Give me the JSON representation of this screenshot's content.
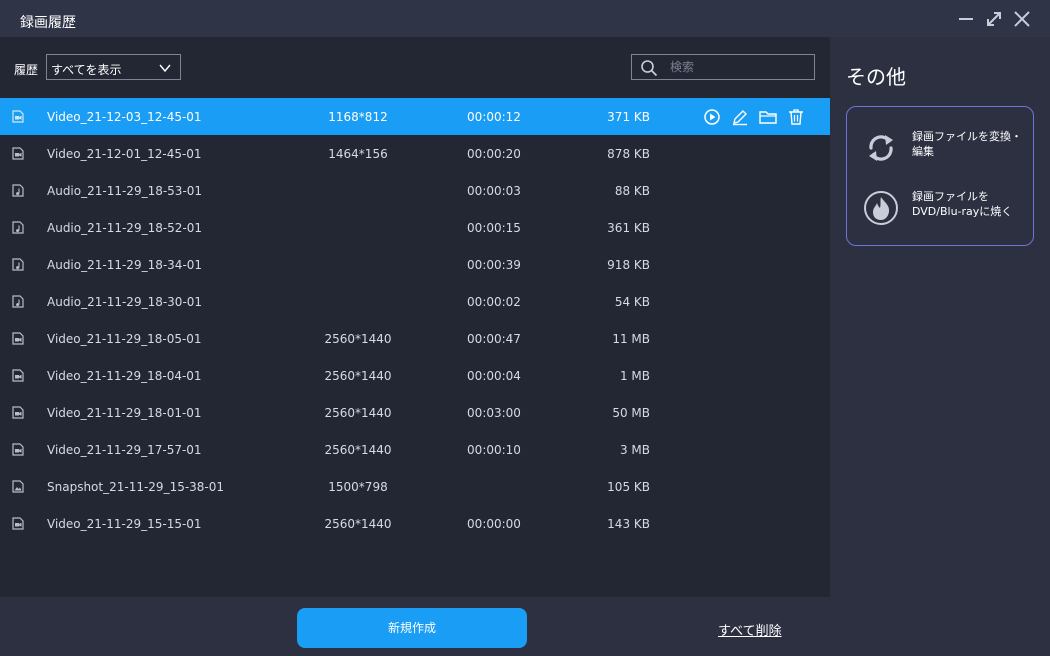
{
  "window": {
    "title": "録画履歴"
  },
  "filter": {
    "label": "履歴",
    "selected": "すべてを表示"
  },
  "search": {
    "placeholder": "検索",
    "value": ""
  },
  "recordings": [
    {
      "name": "Video_21-12-03_12-45-01",
      "type": "video",
      "resolution": "1168*812",
      "duration": "00:00:12",
      "size": "371 KB",
      "selected": true
    },
    {
      "name": "Video_21-12-01_12-45-01",
      "type": "video",
      "resolution": "1464*156",
      "duration": "00:00:20",
      "size": "878 KB"
    },
    {
      "name": "Audio_21-11-29_18-53-01",
      "type": "audio",
      "resolution": "",
      "duration": "00:00:03",
      "size": "88 KB"
    },
    {
      "name": "Audio_21-11-29_18-52-01",
      "type": "audio",
      "resolution": "",
      "duration": "00:00:15",
      "size": "361 KB"
    },
    {
      "name": "Audio_21-11-29_18-34-01",
      "type": "audio",
      "resolution": "",
      "duration": "00:00:39",
      "size": "918 KB"
    },
    {
      "name": "Audio_21-11-29_18-30-01",
      "type": "audio",
      "resolution": "",
      "duration": "00:00:02",
      "size": "54 KB"
    },
    {
      "name": "Video_21-11-29_18-05-01",
      "type": "video",
      "resolution": "2560*1440",
      "duration": "00:00:47",
      "size": "11 MB"
    },
    {
      "name": "Video_21-11-29_18-04-01",
      "type": "video",
      "resolution": "2560*1440",
      "duration": "00:00:04",
      "size": "1 MB"
    },
    {
      "name": "Video_21-11-29_18-01-01",
      "type": "video",
      "resolution": "2560*1440",
      "duration": "00:03:00",
      "size": "50 MB"
    },
    {
      "name": "Video_21-11-29_17-57-01",
      "type": "video",
      "resolution": "2560*1440",
      "duration": "00:00:10",
      "size": "3 MB"
    },
    {
      "name": "Snapshot_21-11-29_15-38-01",
      "type": "image",
      "resolution": "1500*798",
      "duration": "",
      "size": "105 KB"
    },
    {
      "name": "Video_21-11-29_15-15-01",
      "type": "video",
      "resolution": "2560*1440",
      "duration": "00:00:00",
      "size": "143 KB"
    }
  ],
  "row_actions": [
    "play-icon",
    "edit-icon",
    "folder-icon",
    "trash-icon"
  ],
  "footer": {
    "new_label": "新規作成",
    "delete_all_label": "すべて削除"
  },
  "side": {
    "title": "その他",
    "tools": [
      {
        "label": "録画ファイルを変換・編集",
        "icon": "convert-icon"
      },
      {
        "label": "録画ファイルをDVD/Blu-rayに焼く",
        "icon": "burn-icon"
      }
    ]
  },
  "colors": {
    "accent": "#1a9df4",
    "background": "#232733",
    "panel": "#2c3040",
    "card_border": "#6f75d6"
  }
}
